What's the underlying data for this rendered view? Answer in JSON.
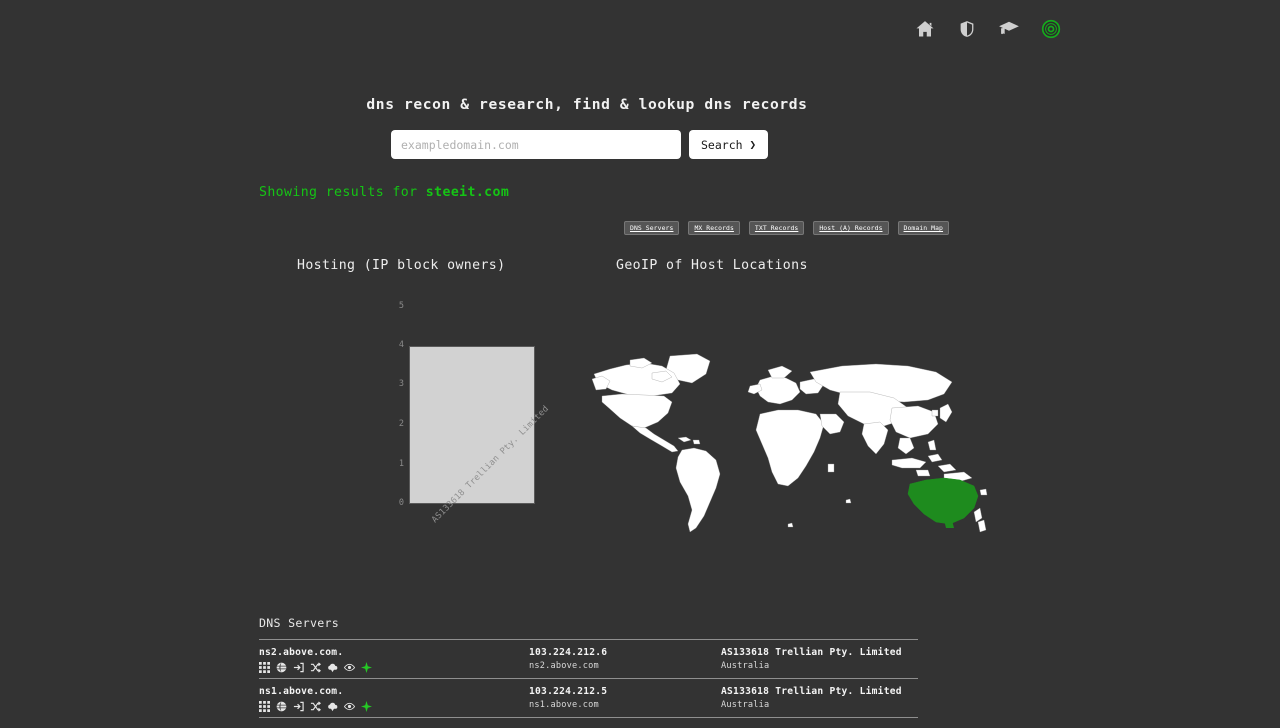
{
  "topnav": {
    "items": [
      {
        "name": "home-icon",
        "label": "Home"
      },
      {
        "name": "shield-icon",
        "label": "Security"
      },
      {
        "name": "graduation-cap-icon",
        "label": "Learn"
      },
      {
        "name": "target-icon",
        "label": "Recon"
      }
    ],
    "active_color": "#16a81d"
  },
  "hero": {
    "title": "dns recon & research, find & lookup dns records"
  },
  "search": {
    "placeholder": "exampledomain.com",
    "value": "",
    "button_label": "Search",
    "button_chevron": "❯"
  },
  "status": {
    "prefix": "Showing results for ",
    "domain": "steeit.com",
    "color": "#15c415"
  },
  "tabs": [
    {
      "label": "DNS_Servers",
      "active": true
    },
    {
      "label": "MX_Records",
      "active": false
    },
    {
      "label": "TXT_Records",
      "active": false
    },
    {
      "label": "Host_(A)_Records",
      "active": false
    },
    {
      "label": "Domain_Map",
      "active": false
    }
  ],
  "panels": {
    "hosting_title": "Hosting (IP block owners)",
    "geoip_title": "GeoIP of Host Locations"
  },
  "chart_data": {
    "type": "bar",
    "title": "Hosting (IP block owners)",
    "categories": [
      "AS133618 Trellian Pty. Limited"
    ],
    "values": [
      4
    ],
    "xlabel": "",
    "ylabel": "",
    "ylim": [
      0,
      5
    ],
    "yticks": [
      "5",
      "4",
      "3",
      "2",
      "1",
      "0"
    ],
    "grid": false,
    "legend": "none",
    "bar_color": "#d2d2d2",
    "bar_border": "#5a5a5a"
  },
  "map": {
    "highlight_country": "Australia",
    "highlight_color": "#1e8b1e",
    "land_color": "#ffffff",
    "ocean_color": "#333333"
  },
  "table": {
    "title": "DNS Servers",
    "row_action_icons": [
      "grid-icon",
      "globe-icon",
      "login-icon",
      "shuffle-icon",
      "cloud-upload-icon",
      "eye-icon",
      "sparkle-icon"
    ],
    "rows": [
      {
        "host": "ns2.above.com.",
        "ip": "103.224.212.6",
        "ptr": "ns2.above.com",
        "asn": "AS133618 Trellian Pty. Limited",
        "country": "Australia"
      },
      {
        "host": "ns1.above.com.",
        "ip": "103.224.212.5",
        "ptr": "ns1.above.com",
        "asn": "AS133618 Trellian Pty. Limited",
        "country": "Australia"
      }
    ]
  }
}
